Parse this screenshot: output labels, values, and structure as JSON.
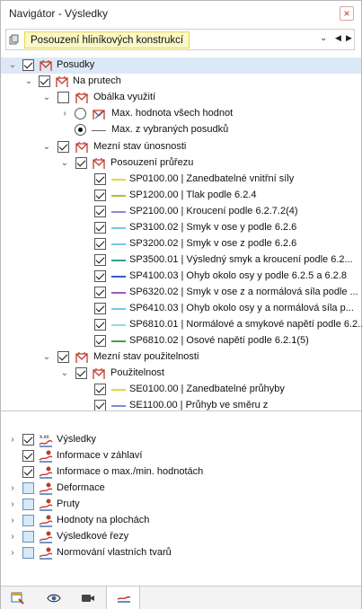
{
  "window": {
    "title": "Navigátor - Výsledky",
    "close_glyph": "×"
  },
  "combo": {
    "value": "Posouzení hliníkových konstrukcí",
    "dropdown_glyph": "⌄",
    "prev_glyph": "◀",
    "next_glyph": "▶"
  },
  "tree": {
    "posudky": "Posudky",
    "na_prutech": "Na prutech",
    "obalka": "Obálka využití",
    "max_vsech": "Max. hodnota všech hodnot",
    "max_vybranych": "Max. z vybraných posudků",
    "mezni_unosnosti": "Mezní stav únosnosti",
    "posouzeni_prurezu": "Posouzení průřezu",
    "sp_items": [
      {
        "label": "SP0100.00 | Zanedbatelné vnitřní síly",
        "color": "#e6d838"
      },
      {
        "label": "SP1200.00 | Tlak podle 6.2.4",
        "color": "#9fc83a"
      },
      {
        "label": "SP2100.00 | Kroucení podle 6.2.7.2(4)",
        "color": "#9a80d8"
      },
      {
        "label": "SP3100.02 | Smyk v ose y podle 6.2.6",
        "color": "#78c8e8"
      },
      {
        "label": "SP3200.02 | Smyk v ose z podle 6.2.6",
        "color": "#78c8e8"
      },
      {
        "label": "SP3500.01 | Výsledný smyk a kroucení podle 6.2...",
        "color": "#2f9e8f"
      },
      {
        "label": "SP4100.03 | Ohyb okolo osy y podle 6.2.5 a 6.2.8",
        "color": "#3d56c8"
      },
      {
        "label": "SP6320.02 | Smyk v ose z a normálová síla podle ...",
        "color": "#a05ab8"
      },
      {
        "label": "SP6410.03 | Ohyb okolo osy y a normálová síla p...",
        "color": "#78c8e8"
      },
      {
        "label": "SP6810.01 | Normálové a smykové napětí podle 6.2...",
        "color": "#8fd8e8"
      },
      {
        "label": "SP6810.02 | Osové napětí podle 6.2.1(5)",
        "color": "#3aa848"
      }
    ],
    "mezni_pouzitelnosti": "Mezní stav použitelnosti",
    "pouzitelnost": "Použitelnost",
    "se_items": [
      {
        "label": "SE0100.00 | Zanedbatelné průhyby",
        "color": "#e6d838"
      },
      {
        "label": "SE1100.00 | Průhyb ve směru z",
        "color": "#7890d8"
      }
    ]
  },
  "lower": [
    {
      "label": "Výsledky",
      "expandable": true,
      "checked": true,
      "icon": "results-xxx-icon"
    },
    {
      "label": "Informace v záhlaví",
      "expandable": false,
      "checked": true,
      "icon": "info-header-icon"
    },
    {
      "label": "Informace o max./min. hodnotách",
      "expandable": false,
      "checked": true,
      "icon": "info-maxmin-icon"
    },
    {
      "label": "Deformace",
      "expandable": true,
      "checked": false,
      "icon": "deformation-icon"
    },
    {
      "label": "Pruty",
      "expandable": true,
      "checked": false,
      "icon": "members-icon"
    },
    {
      "label": "Hodnoty na plochách",
      "expandable": true,
      "checked": false,
      "icon": "surface-values-icon"
    },
    {
      "label": "Výsledkové řezy",
      "expandable": true,
      "checked": false,
      "icon": "result-sections-icon"
    },
    {
      "label": "Normování vlastních tvarů",
      "expandable": true,
      "checked": false,
      "icon": "mode-normalization-icon"
    }
  ],
  "colors": {
    "selection": "#dce8f7",
    "highlight_bg": "#fbf7c6",
    "icon_red": "#c0392b",
    "icon_blue": "#2f6ab0"
  }
}
